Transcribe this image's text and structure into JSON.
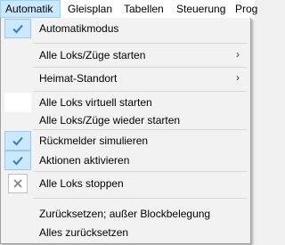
{
  "menubar": {
    "items": [
      {
        "label": "Automatik",
        "active": true
      },
      {
        "label": "Gleisplan"
      },
      {
        "label": "Tabellen"
      },
      {
        "label": "Steuerung"
      },
      {
        "label": "Prog"
      }
    ]
  },
  "menu": {
    "items": [
      {
        "label": "Automatikmodus",
        "checked": true
      },
      {
        "label": "Alle Loks/Züge starten",
        "submenu": true
      },
      {
        "label": "Heimat-Standort",
        "submenu": true
      },
      {
        "label": "Alle Loks virtuell starten"
      },
      {
        "label": "Alle Loks/Züge wieder starten"
      },
      {
        "label": "Rückmelder simulieren",
        "checked": true
      },
      {
        "label": "Aktionen aktivieren",
        "checked": true
      },
      {
        "label": "Alle Loks stoppen",
        "icon": "close-icon"
      },
      {
        "label": "Zurücksetzen; außer Blockbelegung"
      },
      {
        "label": "Alles zurücksetzen"
      }
    ],
    "submenu_arrow": "›"
  },
  "colors": {
    "highlight": "#cce8ff",
    "check": "#2a7fd0"
  }
}
